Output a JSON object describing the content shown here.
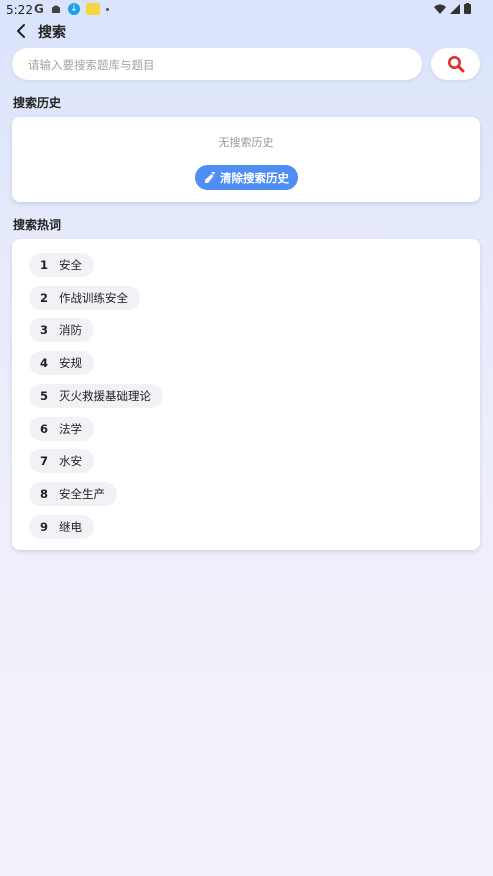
{
  "status_bar": {
    "time": "5:22",
    "g_label": "G"
  },
  "header": {
    "title": "搜索"
  },
  "search": {
    "placeholder": "请输入要搜索题库与题目"
  },
  "history": {
    "title": "搜索历史",
    "empty_text": "无搜索历史",
    "clear_label": "清除搜索历史"
  },
  "hot": {
    "title": "搜索热词",
    "items": [
      {
        "num": "1",
        "word": "安全"
      },
      {
        "num": "2",
        "word": "作战训练安全"
      },
      {
        "num": "3",
        "word": "消防"
      },
      {
        "num": "4",
        "word": "安规"
      },
      {
        "num": "5",
        "word": "灭火救援基础理论"
      },
      {
        "num": "6",
        "word": "法学"
      },
      {
        "num": "7",
        "word": "水安"
      },
      {
        "num": "8",
        "word": "安全生产"
      },
      {
        "num": "9",
        "word": "继电"
      }
    ]
  },
  "colors": {
    "accent": "#4f8ef3",
    "search_icon": "#e0322a"
  }
}
